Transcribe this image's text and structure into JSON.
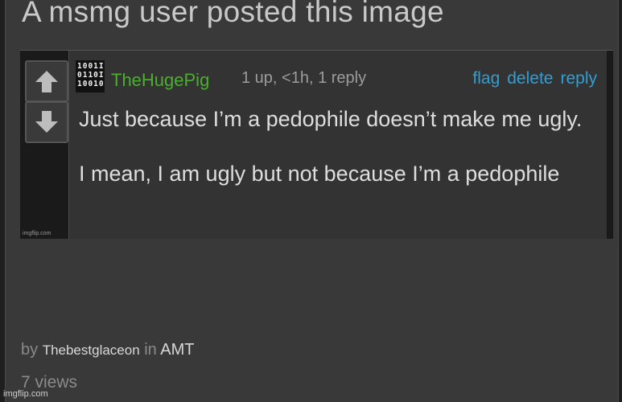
{
  "post": {
    "title": "A msmg user posted this image"
  },
  "screenshot": {
    "watermark_small": "imgflip.com",
    "vote": {
      "up_icon": "arrow-up-icon",
      "down_icon": "arrow-down-icon"
    },
    "comment": {
      "avatar_lines": "1001I\n0110I\n10010",
      "username": "TheHugePig",
      "stats": "1 up, <1h, 1 reply",
      "actions": {
        "flag": "flag",
        "delete": "delete",
        "reply": "reply"
      },
      "text_line1": "Just because I’m a pedophile doesn’t make me ugly.",
      "text_line2": "I mean, I am ugly but not because I’m a pedophile"
    }
  },
  "footer": {
    "by_label": "by",
    "user": "Thebestglaceon",
    "in_label": "in",
    "stream": "AMT",
    "views": "7 views"
  },
  "watermark": "imgflip.com",
  "colors": {
    "username": "#4cae2e",
    "link": "#2f9fd5",
    "panel_bg": "#393939"
  }
}
